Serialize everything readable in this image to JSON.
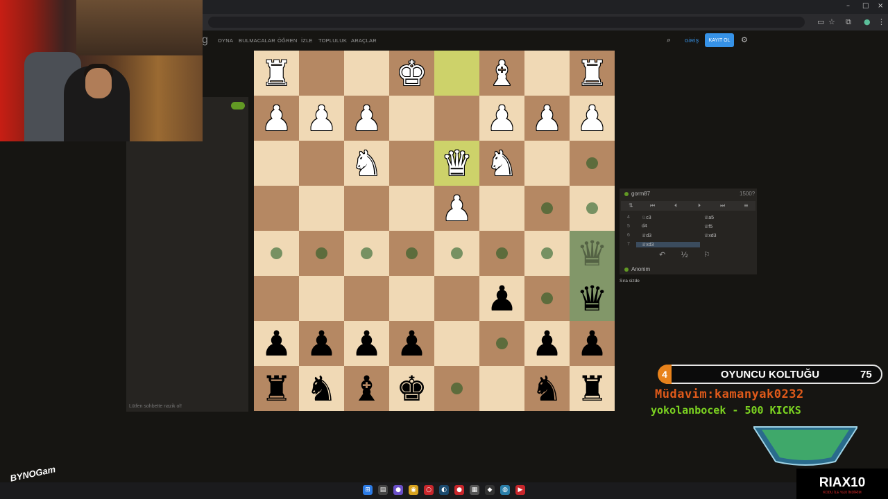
{
  "browser": {
    "window_controls": [
      "–",
      "□",
      "×"
    ],
    "toolbar_icons": [
      "screen-cast-icon",
      "star-icon",
      "extensions-icon",
      "profile-icon",
      "menu-icon"
    ]
  },
  "site": {
    "logo_fragment": "g",
    "nav": [
      "OYNA",
      "BULMACALAR",
      "ÖĞREN",
      "İZLE",
      "TOPLULUK",
      "ARAÇLAR"
    ],
    "login": "GİRİŞ",
    "signup": "KAYIT OL"
  },
  "chat": {
    "placeholder": "Lütfen sohbette nazik ol!"
  },
  "board": {
    "ranks": [
      [
        "wR",
        "",
        "",
        "wK",
        "",
        "wB",
        "",
        "wR"
      ],
      [
        "wP",
        "wP",
        "wP",
        "",
        "",
        "wP",
        "wP",
        "wP"
      ],
      [
        "",
        "",
        "wN",
        "",
        "wQ",
        "wN",
        "",
        ""
      ],
      [
        "",
        "",
        "",
        "",
        "wP",
        "",
        "",
        ""
      ],
      [
        "",
        "",
        "",
        "",
        "",
        "",
        "",
        ""
      ],
      [
        "",
        "",
        "",
        "",
        "",
        "bP",
        "",
        ""
      ],
      [
        "bP",
        "bP",
        "bP",
        "bP",
        "",
        "",
        "bP",
        "bP"
      ],
      [
        "bR",
        "bN",
        "bB",
        "bK",
        "",
        "",
        "bN",
        "bR"
      ]
    ],
    "last_move": [
      [
        0,
        4
      ],
      [
        2,
        4
      ]
    ],
    "selected": [
      [
        4,
        7
      ],
      [
        5,
        7
      ]
    ],
    "dots": [
      [
        2,
        7
      ],
      [
        3,
        6
      ],
      [
        3,
        7
      ],
      [
        4,
        0
      ],
      [
        4,
        1
      ],
      [
        4,
        2
      ],
      [
        4,
        3
      ],
      [
        4,
        4
      ],
      [
        4,
        5
      ],
      [
        4,
        6
      ],
      [
        5,
        6
      ],
      [
        6,
        5
      ],
      [
        7,
        4
      ]
    ],
    "ghost": {
      "square": [
        4,
        7
      ],
      "piece": "♛"
    },
    "dragging": {
      "square": [
        5,
        7
      ],
      "piece": "♛"
    }
  },
  "game": {
    "top_player": "gorm87",
    "top_rating": "1500?",
    "moves": [
      {
        "num": "4",
        "white": "♘c3",
        "black": "♕a5"
      },
      {
        "num": "5",
        "white": "d4",
        "black": "♕f5"
      },
      {
        "num": "6",
        "white": "♕d3",
        "black": "♕xd3"
      },
      {
        "num": "7",
        "white": "♕xd3",
        "black": ""
      }
    ],
    "half_draw": "½",
    "bottom_player": "Anonim",
    "turn_text": "Sıra sizde"
  },
  "overlay": {
    "seat_badge": "4",
    "seat_title": "OYUNCU KOLTUĞU",
    "seat_count": "75",
    "ticker_1": "Müdavim:kamanyak0232",
    "ticker_2": "yokolanbocek - 500 KICKS",
    "sponsor": "RIAX10",
    "sponsor_sub": "KODU İLE %10 İNDİRİM",
    "channel": "BYNOGam"
  },
  "colors": {
    "accent": "#3692e7",
    "light_square": "#f0d9b5",
    "dark_square": "#b58863",
    "online": "#629924"
  }
}
